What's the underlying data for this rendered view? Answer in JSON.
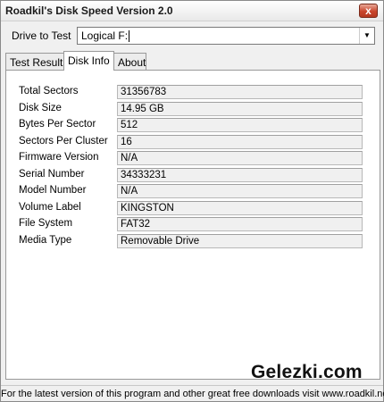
{
  "window": {
    "title": "Roadkil's Disk Speed Version 2.0",
    "close_label": "x"
  },
  "drive": {
    "label": "Drive to Test",
    "value": "Logical F:",
    "dropdown_arrow": "▼"
  },
  "tabs": [
    {
      "label": "Test Results",
      "active": false
    },
    {
      "label": "Disk Info",
      "active": true
    },
    {
      "label": "About",
      "active": false
    }
  ],
  "disk_info": [
    {
      "label": "Total Sectors",
      "value": "31356783"
    },
    {
      "label": "Disk Size",
      "value": "14.95 GB"
    },
    {
      "label": "Bytes Per Sector",
      "value": "512"
    },
    {
      "label": "Sectors Per Cluster",
      "value": "16"
    },
    {
      "label": "Firmware Version",
      "value": "N/A"
    },
    {
      "label": "Serial Number",
      "value": "34333231"
    },
    {
      "label": "Model Number",
      "value": "N/A"
    },
    {
      "label": "Volume Label",
      "value": "KINGSTON"
    },
    {
      "label": "File System",
      "value": "FAT32"
    },
    {
      "label": "Media Type",
      "value": "Removable Drive"
    }
  ],
  "watermark": "Gelezki.com",
  "status": "For the latest version of this program and other great free downloads visit www.roadkil.net"
}
